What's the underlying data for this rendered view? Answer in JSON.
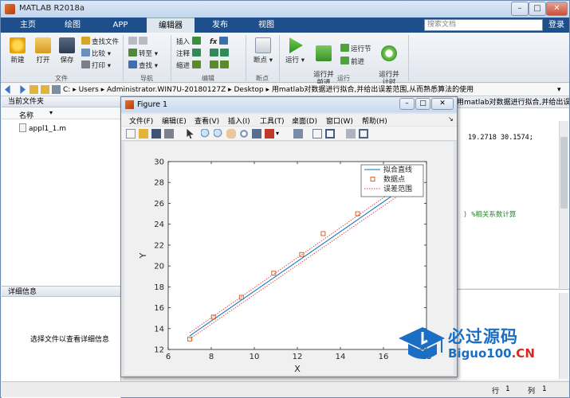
{
  "window": {
    "title": "MATLAB R2018a"
  },
  "tabs": [
    {
      "label": "主页"
    },
    {
      "label": "绘图"
    },
    {
      "label": "APP"
    },
    {
      "label": "编辑器"
    },
    {
      "label": "发布"
    },
    {
      "label": "视图"
    }
  ],
  "search": {
    "placeholder": "搜索文档"
  },
  "login": "登录",
  "ribbon": {
    "file": {
      "new": "新建",
      "open": "打开",
      "save": "保存",
      "find_files": "查找文件",
      "compare": "比较",
      "print": "打印",
      "group": "文件"
    },
    "nav": {
      "goto": "转至",
      "find": "查找",
      "group": "导航"
    },
    "edit": {
      "insert": "插入",
      "comment": "注释",
      "indent": "缩进",
      "fx": "fx",
      "group": "编辑"
    },
    "breakpoints": {
      "breakpoint": "断点",
      "group": "断点"
    },
    "run": {
      "run": "运行",
      "run_advance": "运行并\n前进",
      "run_section": "运行节",
      "advance": "前进",
      "run_time": "运行并\n计时",
      "group": "运行"
    }
  },
  "address": {
    "parts": [
      "C:",
      "Users",
      "Administrator.WIN7U-20180127Z",
      "Desktop",
      "用matlab对数据进行拟合,并给出误差范围,从而熟悉算法的使用"
    ]
  },
  "left_panel": {
    "title": "当前文件夹",
    "column": "名称",
    "files": [
      "appl1_1.m"
    ],
    "details_title": "详细信息",
    "details_msg": "选择文件以查看详细信息"
  },
  "editor": {
    "tabline": "用matlab对数据进行拟合,并给出误差范围,从而熟悉算",
    "line1": "19.2718    30.1574;",
    "line2": ") %相关系数计算"
  },
  "status": {
    "row_label": "行",
    "row": "1",
    "col_label": "列",
    "col": "1"
  },
  "figure": {
    "title": "Figure 1",
    "menus": [
      "文件(F)",
      "编辑(E)",
      "查看(V)",
      "插入(I)",
      "工具(T)",
      "桌面(D)",
      "窗口(W)",
      "帮助(H)"
    ]
  },
  "chart_data": {
    "type": "line",
    "xlabel": "X",
    "ylabel": "Y",
    "xlim": [
      6,
      18
    ],
    "ylim": [
      12,
      30
    ],
    "xticks": [
      6,
      8,
      10,
      12,
      14,
      16,
      18
    ],
    "yticks": [
      12,
      14,
      16,
      18,
      20,
      22,
      24,
      26,
      28,
      30
    ],
    "legend_position": "top-right",
    "series": [
      {
        "name": "拟合直线",
        "style": "line",
        "color": "#0072bd",
        "x": [
          7.0,
          16.6
        ],
        "y": [
          13.3,
          27.0
        ]
      },
      {
        "name": "数据点",
        "style": "markers",
        "color": "#d95319",
        "x": [
          7.0,
          8.1,
          9.4,
          10.9,
          12.2,
          13.2,
          14.8
        ],
        "y": [
          13.0,
          15.1,
          17.0,
          19.3,
          21.1,
          23.1,
          25.0
        ]
      },
      {
        "name": "误差范围",
        "style": "dotted",
        "color": "#e03c3c",
        "upper": {
          "x": [
            7.0,
            16.6
          ],
          "y": [
            13.6,
            27.4
          ]
        },
        "lower": {
          "x": [
            7.0,
            16.6
          ],
          "y": [
            13.0,
            26.6
          ]
        }
      }
    ]
  },
  "watermark": {
    "cn": "必过源码",
    "en_main": "Biguo100",
    "en_tld": ".CN"
  }
}
